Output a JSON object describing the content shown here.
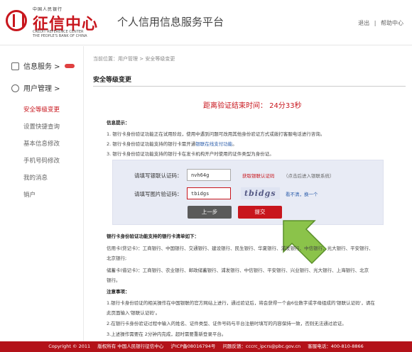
{
  "header": {
    "logo_top": "中国人民银行",
    "logo_main": "征信中心",
    "logo_sub1": "CREDIT REFERENCE CENTER",
    "logo_sub2": "THE PEOPLE'S BANK OF CHINA",
    "platform_title": "个人信用信息服务平台",
    "links": [
      "退出",
      "|",
      "帮助中心"
    ]
  },
  "sidebar": {
    "groups": [
      {
        "label": "信息服务 >"
      },
      {
        "label": "用户管理 >"
      }
    ],
    "items": [
      {
        "label": "安全等级变更"
      },
      {
        "label": "设置快捷查询"
      },
      {
        "label": "基本信息修改"
      },
      {
        "label": "手机号码修改"
      },
      {
        "label": "我的消息"
      },
      {
        "label": "销户"
      }
    ]
  },
  "main": {
    "breadcrumb": "当前位置：用户管理 > 安全等级变更",
    "section_title": "安全等级变更",
    "timer": "距离验证结束时间：  24分33秒",
    "info_title": "信息提示：",
    "info_lines": [
      "1. 银行卡身份验证功能正在试用阶段，使用中遇到问题可改用其他身份验证方式或拨打客服电话进行咨询。",
      "2. 银行卡身份验证功能支持的银行卡需开通",
      "银联在线支付功能",
      "。",
      "3. 银行卡身份验证功能支持的银行卡在发卡机构开户时使用的证件类型为身份证。"
    ],
    "form": {
      "code_label": "请填写银联认证码：",
      "code_value": "nvh64g",
      "get_code": "获取银联认证码",
      "get_code_hint": "（点击后进入银联系统）",
      "captcha_label": "请填写图片验证码：",
      "captcha_value": "tbidgs",
      "captcha_image": "tbidgs",
      "refresh": "看不清，换一个",
      "prev_button": "上一步",
      "submit_button": "提交"
    },
    "bank_list_title": "银行卡身份验证功能支持的银行卡清单如下：",
    "credit_line": "信用卡(贷记卡)：工商银行、中国银行、交通银行、建设银行、民生银行、华夏银行、浦发银行、中信银行、光大银行、平安银行、",
    "credit_line2": "北京银行;",
    "debit_line": "储蓄卡(借记卡)：工商银行、农业银行、邮政储蓄银行、浦发银行、中信银行、平安银行、兴业银行、光大银行、上海银行、北京",
    "debit_line2": "银行。",
    "notes_title": "注意事项：",
    "notes": [
      "1.银行卡身份验证的相关操作在中国银联的官方网站上进行，通过验证后，将会获得一个由6位数字或字母组成的'银联认证码'，请在",
      "此页面输入'银联认证码'。",
      "2.在银行卡身份验证过程中输入的姓名、证件类型、证件号码与平台注册时填写的内容保持一致，否则无法通过验证。",
      "3.上述操作需要在 2分钟内完成，超时需要重新登录平台。"
    ]
  },
  "footer": {
    "items": [
      "Copyright © 2011",
      "版权所有 中国人民银行征信中心",
      "沪ICP备08016794号",
      "问题反馈：cccrc_ipcrs@pbc.gov.cn",
      "客服电话：400-810-8866"
    ]
  },
  "colors": {
    "brand_red": "#c8161d",
    "link_blue": "#2a5caa",
    "panel_bg": "#e8ebf5",
    "arrow_green": "#8bc34a"
  }
}
